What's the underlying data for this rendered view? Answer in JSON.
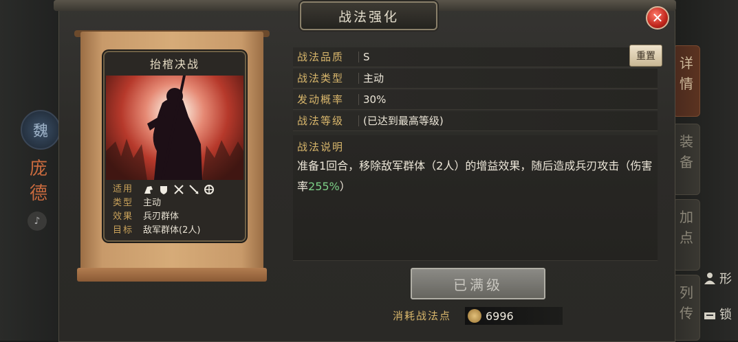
{
  "title": "战法强化",
  "close_icon": "close-icon",
  "hero": {
    "faction": "魏",
    "name": "庞德"
  },
  "side_tabs": [
    "详情",
    "装备",
    "加点",
    "列传"
  ],
  "right_items": [
    {
      "icon": "person-icon",
      "label": "形"
    },
    {
      "icon": "lock-icon",
      "label": "锁"
    }
  ],
  "card": {
    "name": "抬棺决战",
    "rows": [
      {
        "key": "适用",
        "value": ""
      },
      {
        "key": "类型",
        "value": "主动"
      },
      {
        "key": "效果",
        "value": "兵刃群体"
      },
      {
        "key": "目标",
        "value": "敌军群体(2人)"
      }
    ],
    "troop_icons": [
      "cavalry-icon",
      "shield-icon",
      "bow-icon",
      "spear-icon",
      "siege-icon"
    ]
  },
  "info": [
    {
      "label": "战法品质",
      "value": "S"
    },
    {
      "label": "战法类型",
      "value": "主动"
    },
    {
      "label": "发动概率",
      "value": "30%"
    },
    {
      "label": "战法等级",
      "value": "(已达到最高等级)"
    }
  ],
  "reset_label": "重置",
  "description": {
    "title": "战法说明",
    "text_before": "准备1回合，移除敌军群体（2人）的增益效果，随后造成兵刃攻击（伤害率",
    "highlight": "255%",
    "text_after": "）"
  },
  "maxed_label": "已满级",
  "cost": {
    "label": "消耗战法点",
    "value": "6996"
  },
  "colors": {
    "accent_gold": "#d9b76c",
    "highlight_green": "#7ccf86",
    "close_red": "#c0261c"
  }
}
